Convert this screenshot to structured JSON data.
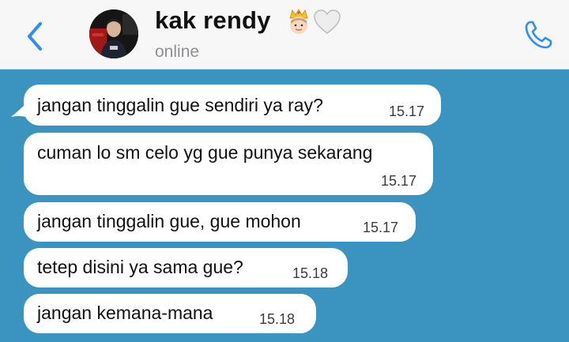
{
  "header": {
    "contact_name": "kak rendy",
    "name_emoji_1": "crown-prince-emoji",
    "name_emoji_2": "white-heart-emoji",
    "status": "online",
    "back_icon": "chevron-left-icon",
    "call_icon": "phone-icon"
  },
  "colors": {
    "chat_background": "#3b93c0",
    "accent": "#2f8ff0",
    "bubble": "#ffffff"
  },
  "messages": [
    {
      "text": "jangan tinggalin gue sendiri ya ray?",
      "time": "15.17"
    },
    {
      "text": "cuman lo sm celo yg gue punya sekarang",
      "time": "15.17"
    },
    {
      "text": "jangan tinggalin gue, gue mohon",
      "time": "15.17"
    },
    {
      "text": "tetep disini ya sama gue?",
      "time": "15.18"
    },
    {
      "text": "jangan kemana-mana",
      "time": "15.18"
    }
  ]
}
